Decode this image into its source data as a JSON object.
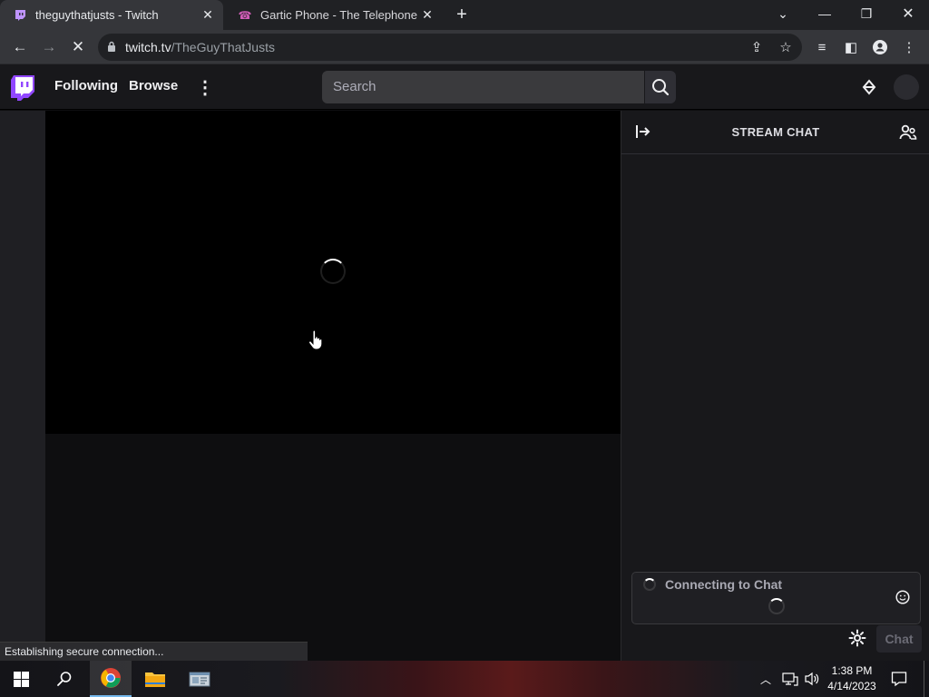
{
  "browser": {
    "tabs": [
      {
        "title": "theguythatjusts - Twitch",
        "active": true
      },
      {
        "title": "Gartic Phone - The Telephone Game",
        "active": false
      }
    ],
    "url_host": "twitch.tv",
    "url_path": "/TheGuyThatJusts",
    "status_text": "Establishing secure connection..."
  },
  "twitch": {
    "nav": {
      "following": "Following",
      "browse": "Browse"
    },
    "search": {
      "placeholder": "Search"
    },
    "brand_color": "#9147ff"
  },
  "chat": {
    "title": "STREAM CHAT",
    "connecting_text": "Connecting to Chat",
    "chat_button": "Chat"
  },
  "taskbar": {
    "time": "1:38 PM",
    "date": "4/14/2023"
  }
}
